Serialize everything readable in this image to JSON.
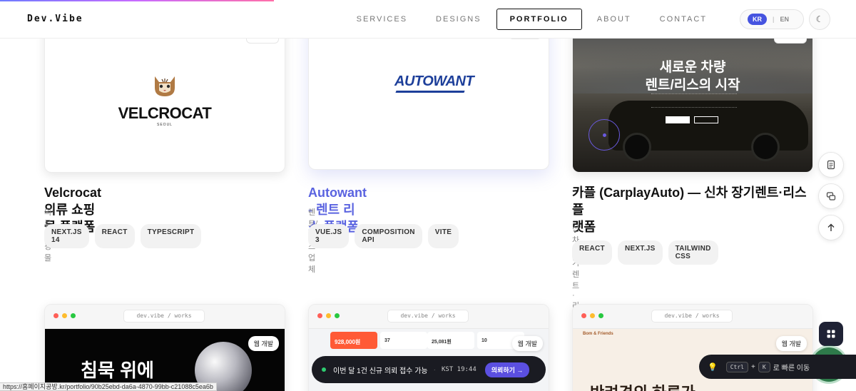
{
  "header": {
    "logo": "Dev.Vibe",
    "nav": [
      {
        "label": "SERVICES"
      },
      {
        "label": "DESIGNS"
      },
      {
        "label": "PORTFOLIO"
      },
      {
        "label": "ABOUT"
      },
      {
        "label": "CONTACT"
      }
    ],
    "active_nav": "PORTFOLIO",
    "lang": {
      "kr": "KR",
      "en": "EN"
    }
  },
  "cards_top": [
    {
      "title": "Velcrocat 의류 쇼핑몰 플랫폼",
      "subtitle": "의류 쇼핑몰",
      "tags": [
        "NEXT.JS 14",
        "REACT",
        "TYPESCRIPT"
      ],
      "logo_text": "VELCROCAT",
      "logo_sub": "SEOUL"
    },
    {
      "title": "Autowant - 렌트 리스 플랫폼",
      "subtitle": "렌트/리스 업체",
      "tags": [
        "VUE.JS 3",
        "COMPOSITION API",
        "VITE"
      ],
      "logo_text": "AUTOWANT"
    },
    {
      "title_line1": "카플 (CarplayAuto) — 신차 장기렌트·리스 플",
      "title_line2": "랫폼",
      "subtitle": "신차 장기렌트·리스 업체",
      "tags": [
        "REACT",
        "NEXT.JS",
        "TAILWIND CSS"
      ],
      "hero_line1": "새로운 차량",
      "hero_line2": "렌트/리스의 시작"
    }
  ],
  "cards_bottom": [
    {
      "url": "dev.vibe / works",
      "badge": "웹 개발",
      "hero": "침묵 위에"
    },
    {
      "url": "dev.vibe / works",
      "badge": "웹 개발",
      "stat1": "928,000원",
      "stat2": "37",
      "stat3": "25,081원",
      "stat4": "10"
    },
    {
      "url": "dev.vibe / works",
      "badge": "웹 개발",
      "brand": "Bom & Friends",
      "hero": "반려견의 하루가"
    }
  ],
  "toast": {
    "message": "이번 달 1건 신규 의뢰 접수 가능",
    "time": "KST 19:44",
    "cta": "의뢰하기 →"
  },
  "hint": {
    "key1": "Ctrl",
    "plus": "+",
    "key2": "K",
    "text": "로 빠른 이동"
  },
  "status_url": "https://홈페이지공방.kr/portfolio/90b25ebd-da6a-4870-99bb-c21088c5ea6b",
  "colors": {
    "accent": "#5a63e0",
    "lang_active": "#4654e0",
    "chat": "#2e7a4a"
  },
  "progress": 0.32
}
